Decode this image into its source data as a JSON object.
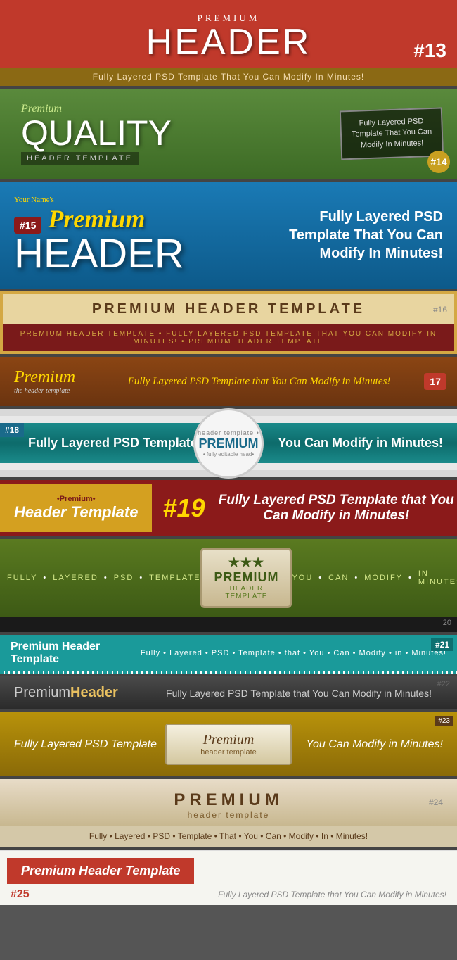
{
  "t13": {
    "pre": "PREMIUM",
    "main": "HEADER",
    "number": "#13",
    "sub": "Fully Layered PSD Template That You Can Modify In Minutes!"
  },
  "t14": {
    "premium": "Premium",
    "quality": "QUALITY",
    "sub": "HEADER TEMPLATE",
    "badge_line1": "Fully Layered PSD",
    "badge_line2": "Template That You Can",
    "badge_line3": "Modify In Minutes!",
    "number": "#14"
  },
  "t15": {
    "your_names": "Your Name's",
    "premium": "Premium",
    "num_badge": "#15",
    "header": "HEADER",
    "right": "Fully Layered PSD Template That You Can Modify In Minutes!"
  },
  "t16": {
    "title": "PREMIUM HEADER TEMPLATE",
    "number": "#16",
    "bottom": "Premium Header Template  •  FULLY LAYERED PSD TEMPLATE THAT YOU CAN MODIFY IN MINUTES!  •  Premium Header Template"
  },
  "t17": {
    "premium": "Premium",
    "sub": "the header template",
    "center": "Fully Layered PSD Template that You Can Modify in Minutes!",
    "number": "17"
  },
  "t18": {
    "num": "#18",
    "left": "Fully Layered PSD Template",
    "badge_pre": "header template •",
    "badge_main": "PREMIUM",
    "badge_sub": "• fully editable head•",
    "right": "You Can Modify in Minutes!"
  },
  "t19": {
    "bullet": "•Premium•",
    "left_main": "Header Template",
    "center_num": "#19",
    "right": "Fully Layered PSD Template that You Can Modify in Minutes!"
  },
  "t20": {
    "left_items": [
      "FULLY",
      "LAYERED",
      "PSD",
      "TEMPLATE"
    ],
    "badge_main": "PREMIUM",
    "badge_sub": "HEADER TEMPLATE",
    "right_items": [
      "YOU",
      "CAN",
      "MODIFY",
      "IN MINUTES"
    ],
    "number": "20"
  },
  "t21": {
    "left": "Premium Header Template",
    "right": "Fully  •  Layered  •  PSD  •  Template  •  that  •  You  •  Can  •  Modify  •  in  •  Minutes!",
    "number": "#21"
  },
  "t22": {
    "premium": "Premium",
    "header": "Header",
    "right": "Fully Layered PSD Template that You Can Modify in Minutes!",
    "number": "#22"
  },
  "t23": {
    "left": "Fully Layered PSD Template",
    "script": "Premium",
    "sub": "header template",
    "right": "You Can Modify in Minutes!",
    "number": "#23"
  },
  "t24": {
    "title": "PREMIUM",
    "sub": "header template",
    "number": "#24",
    "bottom": "Fully  •  Layered  •  PSD  •  Template  •  That  •  You  •  Can  •  Modify  •  In  •  Minutes!"
  },
  "t25": {
    "title": "Premium Header Template",
    "number": "#25",
    "tagline": "Fully Layered PSD Template that You Can Modify in Minutes!"
  }
}
